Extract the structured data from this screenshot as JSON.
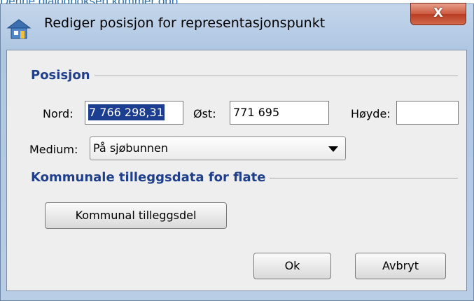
{
  "page_caption": "Denne dialogboksen kommer opp:",
  "window": {
    "title": "Rediger posisjon for representasjonspunkt",
    "close_glyph": "X",
    "close_icon": "close-icon",
    "app_icon": "house-icon"
  },
  "position_section": {
    "title": "Posisjon",
    "nord_label": "Nord:",
    "nord_value": "7 766 298,31",
    "ost_label": "Øst:",
    "ost_value": "771 695",
    "hoyde_label": "Høyde:",
    "hoyde_value": "",
    "medium_label": "Medium:",
    "medium_value": "På sjøbunnen"
  },
  "municipal_section": {
    "title": "Kommunale tilleggsdata for flate",
    "button_label": "Kommunal tilleggsdel"
  },
  "footer": {
    "ok_label": "Ok",
    "cancel_label": "Avbryt"
  },
  "colors": {
    "section_title": "#1f3f8a",
    "selection": "#1c3e91",
    "caption": "#2e74b5"
  }
}
